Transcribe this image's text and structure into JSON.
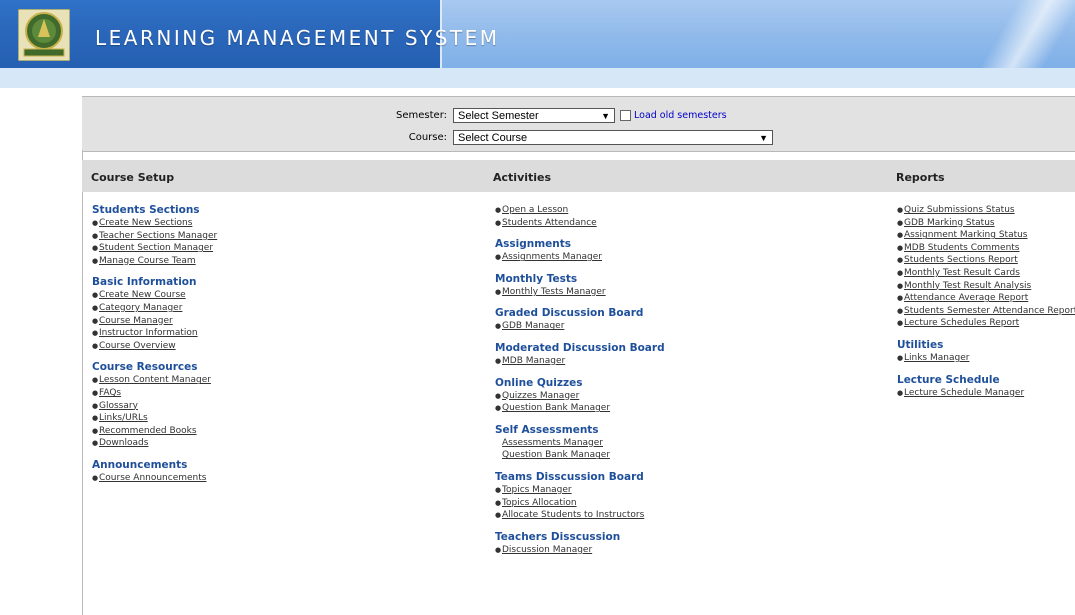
{
  "header": {
    "title": "LEARNING MANAGEMENT SYSTEM",
    "logo_icon": "university-seal-logo"
  },
  "filters": {
    "semester_label": "Semester:",
    "semester_value": "Select Semester",
    "load_old_label": "Load old semesters",
    "course_label": "Course:",
    "course_value": "Select Course"
  },
  "sections": {
    "course_setup": "Course Setup",
    "activities": "Activities",
    "reports": "Reports"
  },
  "course_setup": [
    {
      "title": "Students Sections",
      "links": [
        "Create New Sections",
        "Teacher Sections Manager",
        "Student Section Manager",
        "Manage Course Team"
      ]
    },
    {
      "title": "Basic Information",
      "links": [
        "Create New Course",
        "Category Manager",
        "Course Manager",
        "Instructor Information",
        "Course Overview"
      ]
    },
    {
      "title": "Course Resources",
      "links": [
        "Lesson Content Manager",
        "FAQs",
        "Glossary",
        "Links/URLs",
        "Recommended Books",
        "Downloads"
      ]
    },
    {
      "title": "Announcements",
      "links": [
        "Course Announcements"
      ]
    }
  ],
  "activities": [
    {
      "title": "",
      "links": [
        "Open a Lesson",
        "Students Attendance"
      ]
    },
    {
      "title": "Assignments",
      "links": [
        "Assignments Manager"
      ]
    },
    {
      "title": "Monthly Tests",
      "links": [
        "Monthly Tests Manager"
      ]
    },
    {
      "title": "Graded Discussion Board",
      "links": [
        "GDB Manager"
      ]
    },
    {
      "title": "Moderated Discussion Board",
      "links": [
        "MDB Manager"
      ]
    },
    {
      "title": "Online Quizzes",
      "links": [
        "Quizzes Manager",
        "Question Bank Manager"
      ]
    },
    {
      "title": "Self Assessments",
      "links": [
        "Assessments Manager",
        "Question Bank Manager"
      ]
    },
    {
      "title": "Teams Disscussion Board",
      "links": [
        "Topics Manager",
        "Topics Allocation",
        "Allocate Students to Instructors"
      ]
    },
    {
      "title": "Teachers Disscussion",
      "links": [
        "Discussion Manager"
      ]
    }
  ],
  "reports": [
    {
      "title": "",
      "links": [
        "Quiz Submissions Status",
        "GDB Marking Status",
        "Assignment Marking Status",
        "MDB Students Comments",
        "Students Sections Report",
        "Monthly Test Result Cards",
        "Monthly Test Result Analysis",
        "Attendance Average Report",
        "Students Semester Attendance Report",
        "Lecture Schedules Report"
      ]
    },
    {
      "title": "Utilities",
      "links": [
        "Links Manager"
      ]
    },
    {
      "title": "Lecture Schedule",
      "links": [
        "Lecture Schedule Manager"
      ]
    }
  ]
}
